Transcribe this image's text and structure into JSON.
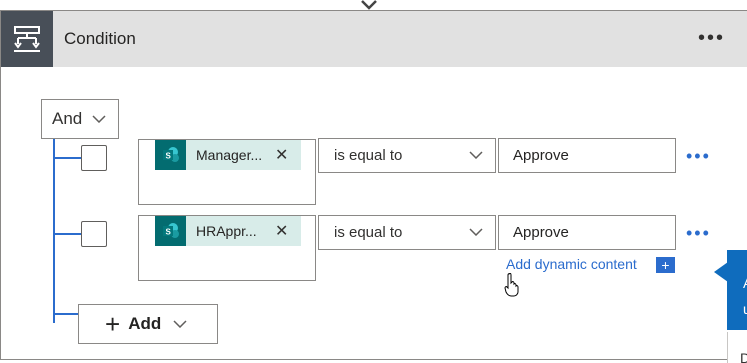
{
  "card": {
    "title": "Condition",
    "more_label": "•••"
  },
  "group": {
    "operator": "And"
  },
  "rows": [
    {
      "token_label": "Manager...",
      "operator": "is equal to",
      "value": "Approve",
      "more_label": "•••"
    },
    {
      "token_label": "HRAppr...",
      "operator": "is equal to",
      "value": "Approve",
      "more_label": "•••"
    }
  ],
  "dynamic_content": {
    "label": "Add dynamic content",
    "plus": "+"
  },
  "add_button": {
    "label": "Add",
    "plus": "+"
  },
  "callout": {
    "text": "A u",
    "below_text": "D"
  },
  "colors": {
    "accent": "#2b6ccd",
    "header_bg": "#e1e1e1",
    "icon_bg": "#484f58",
    "sharepoint": "#036c70",
    "token_bg": "#d8ece9"
  },
  "icons": {
    "condition": "condition-icon",
    "sharepoint": "sharepoint-icon",
    "chevron": "chevron-down-icon",
    "close": "close-icon"
  }
}
